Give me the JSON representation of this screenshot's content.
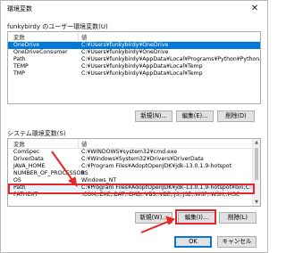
{
  "window": {
    "title": "環境変数",
    "close_glyph": "✕"
  },
  "user_section": {
    "label": "funkybirdy のユーザー環境変数(U)",
    "headers": [
      "変数",
      "値"
    ],
    "rows": [
      {
        "name": "OneDrive",
        "value": "C:¥Users¥funkybirdy¥OneDrive"
      },
      {
        "name": "OneDriveConsumer",
        "value": "C:¥Users¥funkybirdy¥OneDrive"
      },
      {
        "name": "Path",
        "value": "C:¥Users¥funkybirdy¥AppData¥Local¥Programs¥Python¥Python37-..."
      },
      {
        "name": "TEMP",
        "value": "C:¥Users¥funkybirdy¥AppData¥Local¥Temp"
      },
      {
        "name": "TMP",
        "value": "C:¥Users¥funkybirdy¥AppData¥Local¥Temp"
      }
    ],
    "buttons": {
      "new": "新規(N)...",
      "edit": "編集(E)...",
      "delete": "削除(D)"
    }
  },
  "system_section": {
    "label": "システム環境変数(S)",
    "headers": [
      "変数",
      "値"
    ],
    "rows": [
      {
        "name": "ComSpec",
        "value": "C:¥WINDOWS¥system32¥cmd.exe"
      },
      {
        "name": "DriverData",
        "value": "C:¥Windows¥System32¥Drivers¥DriverData"
      },
      {
        "name": "JAVA_HOME",
        "value": "C:¥Program Files¥AdoptOpenJDK¥jdk-13.0.1.9-hotspot"
      },
      {
        "name": "NUMBER_OF_PROCESSORS",
        "value": "8"
      },
      {
        "name": "OS",
        "value": "Windows_NT"
      },
      {
        "name": "Path",
        "value": "C:¥Program Files¥AdoptOpenJDK¥jdk-13.0.1.9-hotspot¥bin;C:¥Progr..."
      },
      {
        "name": "PATHEXT",
        "value": ".COM;.EXE;.BAT;.CMD;.VBS;.VBE;.JS;.JSE;.WSF;.WSH;.MSC"
      }
    ],
    "buttons": {
      "new": "新規(W)...",
      "edit": "編集(I)...",
      "delete": "削除(L)"
    }
  },
  "footer": {
    "ok": "OK",
    "cancel": "キャンセル"
  },
  "colors": {
    "selection": "#0078d7",
    "annotation": "#e8262a"
  }
}
